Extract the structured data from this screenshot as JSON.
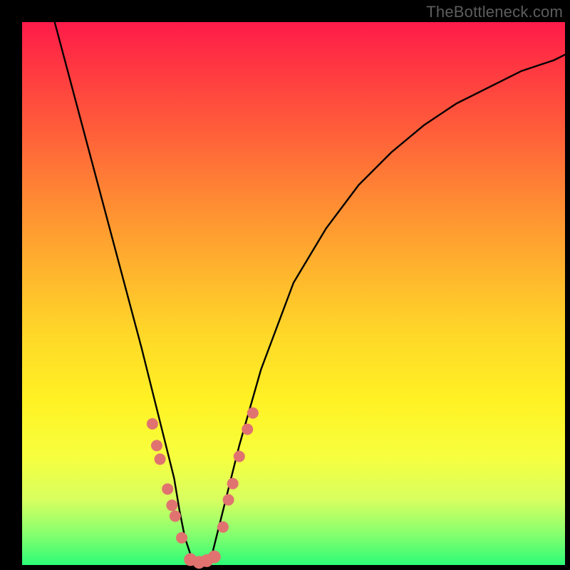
{
  "watermark": "TheBottleneck.com",
  "chart_data": {
    "type": "line",
    "title": "",
    "xlabel": "",
    "ylabel": "",
    "xlim": [
      0,
      100
    ],
    "ylim": [
      0,
      100
    ],
    "grid": false,
    "series": [
      {
        "name": "curve",
        "x": [
          6,
          10,
          14,
          18,
          22,
          24,
          26,
          28,
          29,
          30,
          31,
          32,
          33,
          34,
          35,
          36,
          38,
          40,
          44,
          50,
          56,
          62,
          68,
          74,
          80,
          86,
          92,
          98,
          100
        ],
        "y": [
          100,
          85,
          70,
          55,
          40,
          32,
          24,
          16,
          10,
          5,
          2,
          0,
          0,
          0,
          2,
          6,
          14,
          22,
          36,
          52,
          62,
          70,
          76,
          81,
          85,
          88,
          91,
          93,
          94
        ]
      }
    ],
    "markers": [
      {
        "x": 24.0,
        "y": 26.0,
        "r": 8
      },
      {
        "x": 24.8,
        "y": 22.0,
        "r": 8
      },
      {
        "x": 25.4,
        "y": 19.5,
        "r": 8
      },
      {
        "x": 26.8,
        "y": 14.0,
        "r": 8
      },
      {
        "x": 27.6,
        "y": 11.0,
        "r": 8
      },
      {
        "x": 28.2,
        "y": 9.0,
        "r": 8
      },
      {
        "x": 29.4,
        "y": 5.0,
        "r": 8
      },
      {
        "x": 31.0,
        "y": 1.0,
        "r": 9
      },
      {
        "x": 32.6,
        "y": 0.5,
        "r": 9
      },
      {
        "x": 34.0,
        "y": 0.8,
        "r": 9
      },
      {
        "x": 35.4,
        "y": 1.5,
        "r": 9
      },
      {
        "x": 37.0,
        "y": 7.0,
        "r": 8
      },
      {
        "x": 38.0,
        "y": 12.0,
        "r": 8
      },
      {
        "x": 38.8,
        "y": 15.0,
        "r": 8
      },
      {
        "x": 40.0,
        "y": 20.0,
        "r": 8
      },
      {
        "x": 41.5,
        "y": 25.0,
        "r": 8
      },
      {
        "x": 42.5,
        "y": 28.0,
        "r": 8
      }
    ],
    "marker_color": "#e0736f",
    "curve_color": "#000000",
    "background_gradient": [
      "#ff1b4a",
      "#ffd928",
      "#2dfc76"
    ]
  }
}
